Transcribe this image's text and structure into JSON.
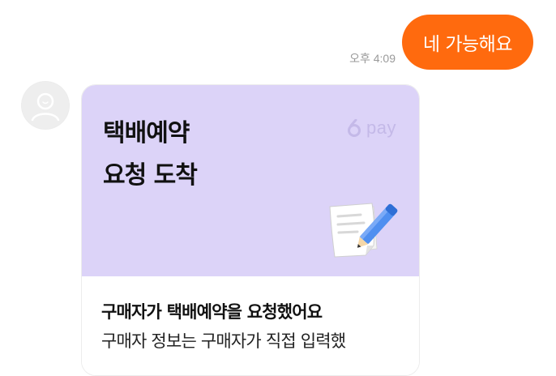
{
  "outgoing_message": {
    "text": "네 가능해요",
    "time": "오후 4:09",
    "bubble_color": "#ff6a0e"
  },
  "incoming_card": {
    "title_line1": "택배예약",
    "title_line2": "요청 도착",
    "brand_logo": "pay",
    "illustration_icon": "document-pencil-icon",
    "subtitle": "구매자가 택배예약을 요청했어요",
    "body": "구매자 정보는 구매자가 직접 입력했",
    "header_color": "#dcd3f8"
  }
}
